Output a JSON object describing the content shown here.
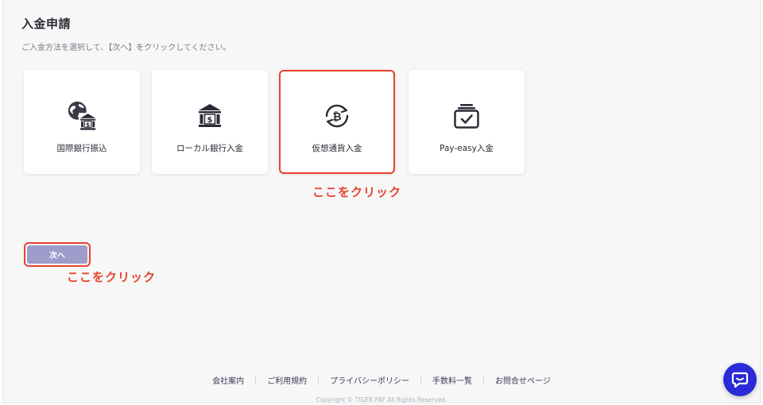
{
  "page": {
    "title": "入金申請",
    "instruction": "ご入金方法を選択して、【次へ】をクリックしてください。"
  },
  "methods": [
    {
      "label": "国際銀行振込",
      "icon": "globe-bank-icon"
    },
    {
      "label": "ローカル銀行入金",
      "icon": "bank-icon"
    },
    {
      "label": "仮想通貨入金",
      "icon": "bitcoin-icon",
      "highlighted": true
    },
    {
      "label": "Pay-easy入金",
      "icon": "checkbox-tray-icon"
    }
  ],
  "annotations": {
    "method_hint": "ここをクリック",
    "next_hint": "ここをクリック"
  },
  "next_button": {
    "label": "次へ"
  },
  "footer": {
    "links": [
      "会社案内",
      "ご利用規約",
      "プライバシーポリシー",
      "手数料一覧",
      "お問合せページ"
    ],
    "copyright": "Copyright © TIGER PAY All Rights Reserved."
  },
  "chat": {
    "icon": "chat-bubble-icon"
  },
  "colors": {
    "highlight": "#e8432c",
    "button": "#9f9bcb",
    "chat": "#2a2ad8",
    "text": "#2b2b36"
  }
}
